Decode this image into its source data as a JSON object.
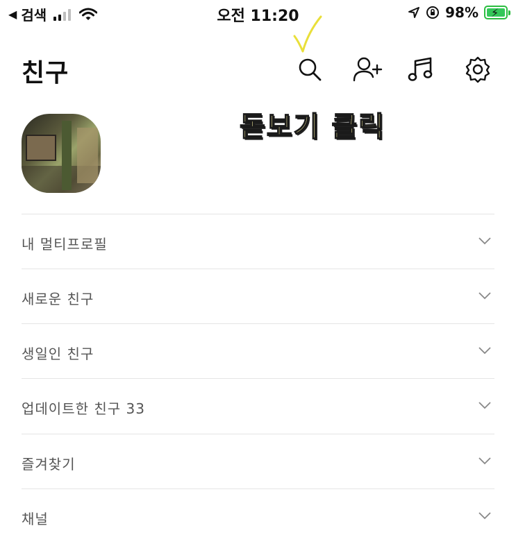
{
  "status_bar": {
    "back_label": "검색",
    "time": "오전 11:20",
    "battery": "98%",
    "icons": [
      "back-arrow-icon",
      "cellular-signal-icon",
      "wifi-icon",
      "location-arrow-icon",
      "orientation-lock-icon",
      "battery-charging-icon"
    ]
  },
  "header": {
    "title": "친구",
    "icons": [
      "search-icon",
      "add-friend-icon",
      "music-icon",
      "settings-icon"
    ]
  },
  "annotation": {
    "text": "돋보기 클릭",
    "mark": "check-mark"
  },
  "sections": [
    {
      "label": "내 멀티프로필"
    },
    {
      "label": "새로운 친구"
    },
    {
      "label": "생일인 친구"
    },
    {
      "label": "업데이트한 친구 33"
    },
    {
      "label": "즐겨찾기"
    },
    {
      "label": "채널"
    }
  ],
  "colors": {
    "annotation_fill": "#f8f0a0",
    "battery_green": "#34c759",
    "divider": "#e5e5e5"
  }
}
